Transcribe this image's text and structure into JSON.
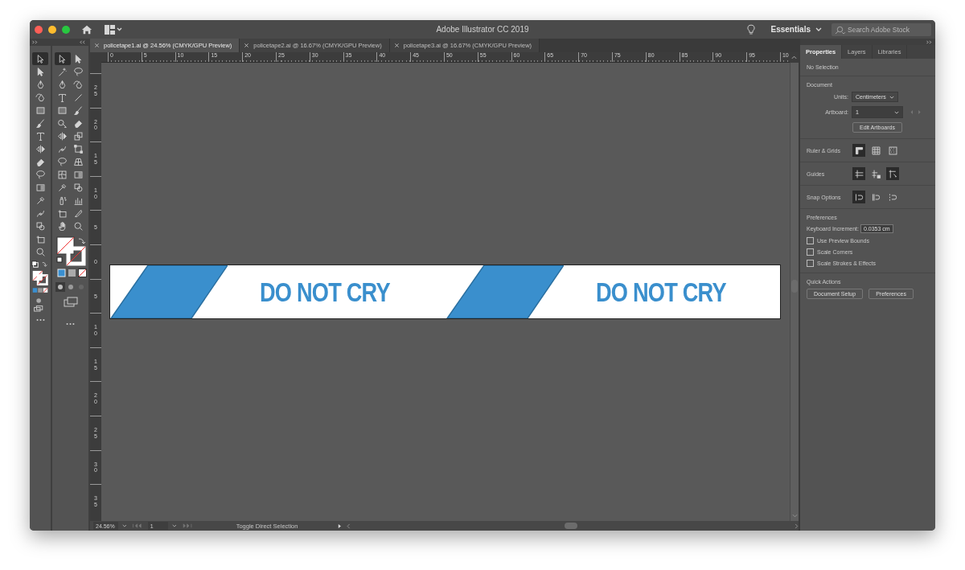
{
  "window": {
    "title": "Adobe Illustrator CC 2019"
  },
  "header": {
    "workspace": "Essentials",
    "search": {
      "placeholder": "Search Adobe Stock"
    }
  },
  "document_tabs": [
    {
      "label": "policetape1.ai @ 24.56% (CMYK/GPU Preview)",
      "selected": true
    },
    {
      "label": "policetape2.ai @ 16.67% (CMYK/GPU Preview)",
      "selected": false
    },
    {
      "label": "policetape3.ai @ 16.67% (CMYK/GPU Preview)",
      "selected": false
    }
  ],
  "horizontal_ruler": [
    "0",
    "5",
    "10",
    "15",
    "20",
    "25",
    "30",
    "35",
    "40",
    "45",
    "50",
    "55",
    "60",
    "65",
    "70",
    "75",
    "80",
    "85",
    "90",
    "95",
    "10"
  ],
  "vertical_ruler": [
    "25",
    "20",
    "15",
    "10",
    "5",
    "0",
    "5",
    "10",
    "15",
    "20",
    "25",
    "30",
    "35"
  ],
  "toolbars": [
    {
      "tools": [
        {
          "selected": true
        },
        {
          "selected": false
        },
        {
          "selected": false
        },
        {
          "selected": false
        },
        {
          "selected": false
        },
        {
          "selected": false
        },
        {
          "selected": false
        },
        {
          "selected": false
        },
        {
          "selected": false
        },
        {
          "selected": false
        },
        {
          "selected": false
        },
        {
          "selected": false
        },
        {
          "selected": false
        },
        {
          "selected": false
        },
        {
          "selected": false
        },
        {
          "selected": false
        }
      ]
    },
    {
      "tools": [
        {
          "selected": true
        },
        {
          "selected": false
        },
        {
          "selected": false
        },
        {
          "selected": false
        },
        {
          "selected": false
        },
        {
          "selected": false
        },
        {
          "selected": false
        },
        {
          "selected": false
        },
        {
          "selected": false
        },
        {
          "selected": false
        },
        {
          "selected": false
        },
        {
          "selected": false
        },
        {
          "selected": false
        },
        {
          "selected": false
        },
        {
          "selected": false
        },
        {
          "selected": false
        },
        {
          "selected": false
        },
        {
          "selected": false
        },
        {
          "selected": false
        },
        {
          "selected": false
        },
        {
          "selected": false
        },
        {
          "selected": false
        },
        {
          "selected": false
        },
        {
          "selected": false
        },
        {
          "selected": false
        },
        {
          "selected": false
        },
        {
          "selected": false
        },
        {
          "selected": false
        }
      ]
    }
  ],
  "artboard": {
    "segments": [
      {
        "text": "DO NOT CRY"
      },
      {
        "text": "DO NOT CRY"
      }
    ]
  },
  "status_bar": {
    "zoom": "24.56%",
    "page": "1",
    "tool_hint": "Toggle Direct Selection"
  },
  "panel": {
    "tabs": [
      {
        "label": "Properties",
        "selected": true
      },
      {
        "label": "Layers",
        "selected": false
      },
      {
        "label": "Libraries",
        "selected": false
      }
    ],
    "selection": "No Selection",
    "document": {
      "heading": "Document",
      "units_label": "Units:",
      "units": "Centimeters",
      "artboard_label": "Artboard:",
      "artboard": "1",
      "edit_button": "Edit Artboards"
    },
    "ruler_grids": {
      "label": "Ruler & Grids",
      "toggles": [
        {
          "on": true
        },
        {
          "on": false
        },
        {
          "on": false
        }
      ]
    },
    "guides": {
      "label": "Guides",
      "toggles": [
        {
          "on": true
        },
        {
          "on": false
        },
        {
          "on": true
        }
      ]
    },
    "snap_options": {
      "label": "Snap Options",
      "toggles": [
        {
          "on": true
        },
        {
          "on": false
        },
        {
          "on": false
        }
      ]
    },
    "preferences": {
      "heading": "Preferences",
      "increment_label": "Keyboard Increment:",
      "increment": "0.0353 cm",
      "options": [
        {
          "label": "Use Preview Bounds",
          "checked": false
        },
        {
          "label": "Scale Corners",
          "checked": false
        },
        {
          "label": "Scale Strokes & Effects",
          "checked": false
        }
      ]
    },
    "quick_actions": {
      "heading": "Quick Actions",
      "buttons": [
        "Document Setup",
        "Preferences"
      ]
    }
  }
}
